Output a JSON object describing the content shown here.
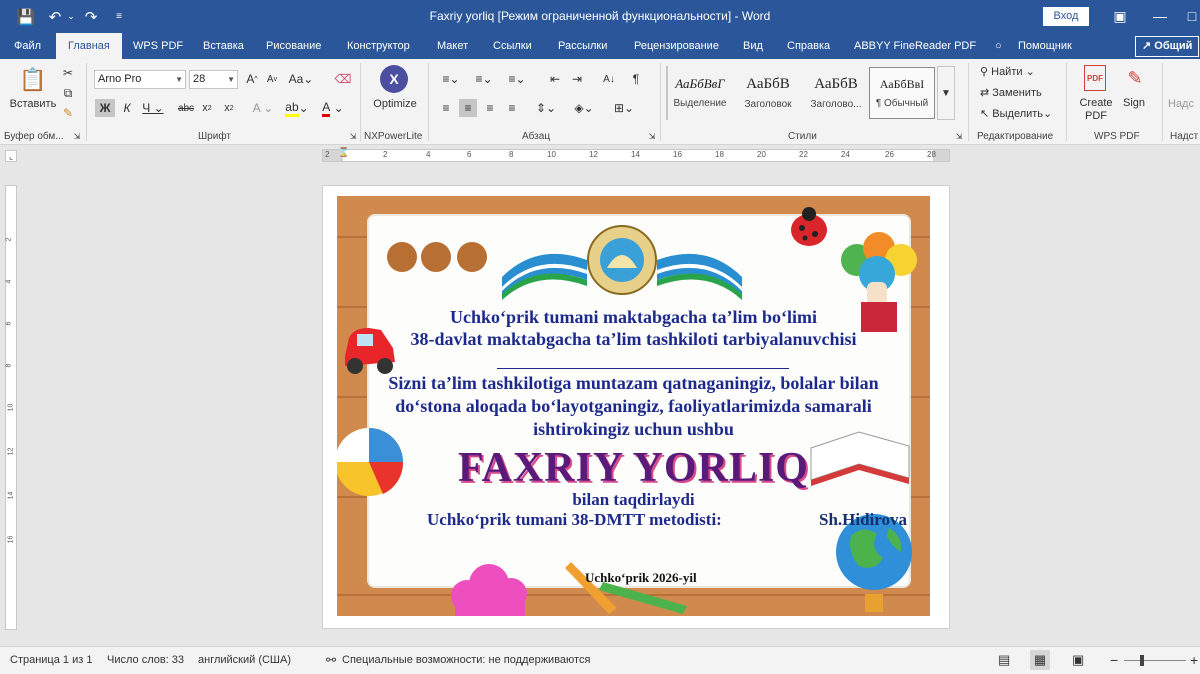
{
  "titlebar": {
    "title": "Faxriy yorliq [Режим ограниченной функциональности]  -  Word",
    "login": "Вход"
  },
  "tabs": [
    "Файл",
    "Главная",
    "WPS PDF",
    "Вставка",
    "Рисование",
    "Конструктор",
    "Макет",
    "Ссылки",
    "Рассылки",
    "Рецензирование",
    "Вид",
    "Справка",
    "ABBYY FineReader PDF",
    "Помощник"
  ],
  "share": "Общий",
  "ribbon": {
    "paste": "Вставить",
    "font_name": "Arno Pro",
    "font_size": "28",
    "optimize": "Optimize",
    "styles": [
      {
        "preview": "АаБбВвГ",
        "name": "Выделение"
      },
      {
        "preview": "АаБбВ",
        "name": "Заголовок"
      },
      {
        "preview": "АаБбВ",
        "name": "Заголово..."
      },
      {
        "preview": "АаБбВвI",
        "name": "¶ Обычный"
      }
    ],
    "find": "Найти",
    "replace": "Заменить",
    "select": "Выделить",
    "create_pdf": "Create PDF",
    "sign": "Sign",
    "nad": "Надс",
    "groups": {
      "clipboard": "Буфер обм...",
      "font": "Шрифт",
      "nxpower": "NXPowerLite",
      "paragraph": "Абзац",
      "styles": "Стили",
      "editing": "Редактирование",
      "wps": "WPS PDF",
      "nad": "Надст"
    }
  },
  "ruler": [
    "2",
    "2",
    "4",
    "6",
    "8",
    "10",
    "12",
    "14",
    "16",
    "18",
    "20",
    "22",
    "24",
    "26",
    "28"
  ],
  "vruler": [
    "2",
    "4",
    "6",
    "8",
    "10",
    "12",
    "14",
    "16"
  ],
  "certificate": {
    "line1": "Uchko‘prik tumani maktabgacha ta’lim bo‘limi",
    "line2": "38-davlat maktabgacha ta’lim tashkiloti tarbiyalanuvchisi",
    "line3": "Sizni ta’lim tashkilotiga muntazam qatnaganingiz, bolalar bilan",
    "line4": "do‘stona aloqada bo‘layotganingiz, faoliyatlarimizda samarali",
    "line5": "ishtirokingiz  uchun ushbu",
    "title": "FAXRIY YORLIQ",
    "line6": "bilan taqdirlaydi",
    "line7": "Uchko‘prik tumani 38-DMTT metodisti:",
    "signer": "Sh.Hidirova",
    "footer": "Uchko‘prik 2026-yil"
  },
  "status": {
    "page": "Страница 1 из 1",
    "words": "Число слов: 33",
    "language": "английский (США)",
    "accessibility": "Специальные возможности: не поддерживаются"
  },
  "colors": {
    "word_blue": "#2b579a",
    "cert_text": "#1d2a8c",
    "cert_title": "#5a1a7a"
  }
}
